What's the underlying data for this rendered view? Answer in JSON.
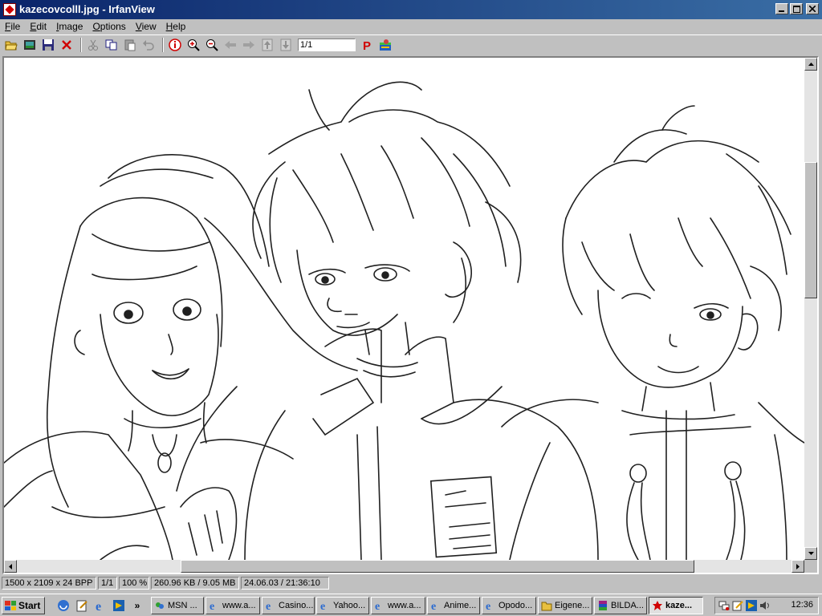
{
  "window": {
    "title": "kazecovcolll.jpg - IrfanView"
  },
  "menu": [
    {
      "key": "F",
      "rest": "ile"
    },
    {
      "key": "E",
      "rest": "dit"
    },
    {
      "key": "I",
      "rest": "mage"
    },
    {
      "key": "O",
      "rest": "ptions"
    },
    {
      "key": "V",
      "rest": "iew"
    },
    {
      "key": "H",
      "rest": "elp"
    }
  ],
  "toolbar": {
    "page_value": "1/1",
    "icons": [
      "open-folder-icon",
      "slideshow-icon",
      "save-icon",
      "delete-icon",
      "cut-icon",
      "copy-icon",
      "paste-icon",
      "undo-icon",
      "info-icon",
      "zoom-in-icon",
      "zoom-out-icon",
      "previous-icon",
      "next-icon",
      "first-page-icon",
      "last-page-icon",
      "print-icon",
      "about-icon"
    ]
  },
  "status": {
    "dimensions": "1500 x 2109 x 24 BPP",
    "page": "1/1",
    "zoom": "100 %",
    "filesize": "260.96 KB / 9.05 MB",
    "datetime": "24.06.03 / 21:36:10"
  },
  "taskbar": {
    "start_label": "Start",
    "tasks": [
      {
        "label": "MSN ...",
        "icon": "msn-icon"
      },
      {
        "label": "www.a...",
        "icon": "ie-icon"
      },
      {
        "label": "Casino...",
        "icon": "ie-icon"
      },
      {
        "label": "Yahoo...",
        "icon": "ie-icon"
      },
      {
        "label": "www.a...",
        "icon": "ie-icon"
      },
      {
        "label": "Anime...",
        "icon": "ie-icon"
      },
      {
        "label": "Opodo...",
        "icon": "ie-icon"
      },
      {
        "label": "Eigene...",
        "icon": "folder-icon"
      },
      {
        "label": "BILDA...",
        "icon": "winrar-icon"
      },
      {
        "label": "kaze...",
        "icon": "irfanview-icon"
      }
    ],
    "chevron": "»",
    "clock": "12:36"
  },
  "colors": {
    "titlebar_start": "#0a246a",
    "titlebar_end": "#3a6ea5",
    "chrome": "#c0c0c0"
  }
}
